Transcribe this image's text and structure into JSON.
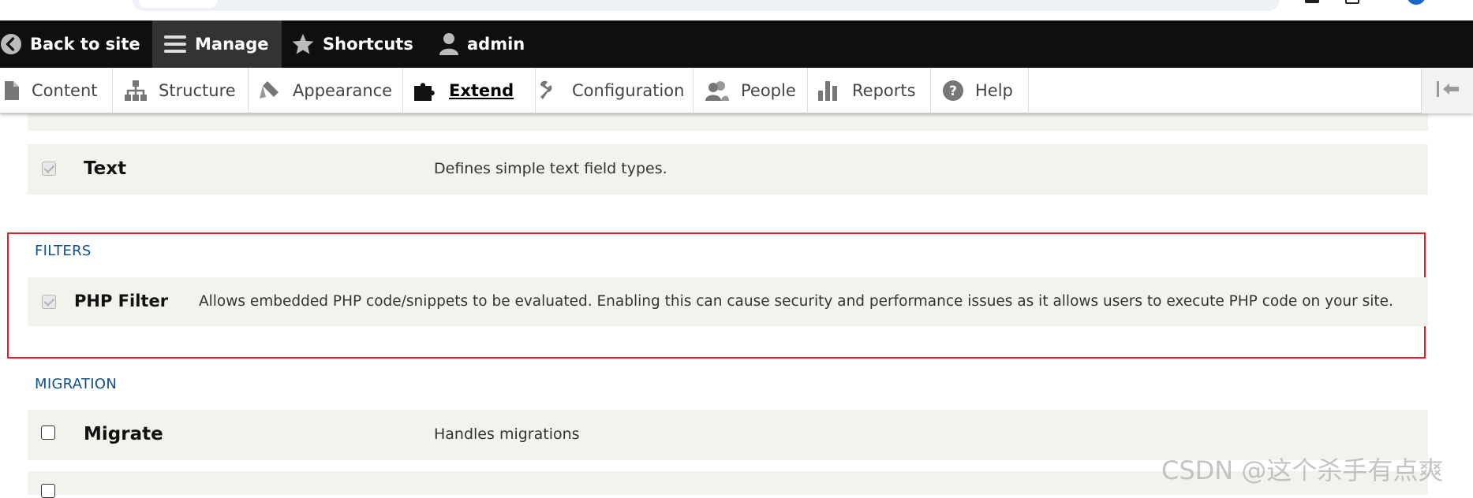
{
  "toolbar": {
    "back_to_site": "Back to site",
    "manage": "Manage",
    "shortcuts": "Shortcuts",
    "user": "admin"
  },
  "tray": {
    "items": [
      {
        "label": "Content",
        "icon": "file-icon"
      },
      {
        "label": "Structure",
        "icon": "sitemap-icon"
      },
      {
        "label": "Appearance",
        "icon": "paintbrush-icon"
      },
      {
        "label": "Extend",
        "icon": "puzzle-icon",
        "active": true
      },
      {
        "label": "Configuration",
        "icon": "wrench-icon"
      },
      {
        "label": "People",
        "icon": "people-icon"
      },
      {
        "label": "Reports",
        "icon": "bar-chart-icon"
      },
      {
        "label": "Help",
        "icon": "help-icon"
      }
    ]
  },
  "modules": {
    "text": {
      "name": "Text",
      "description": "Defines simple text field types.",
      "checked": true,
      "disabled": true
    },
    "filters": {
      "section_title": "FILTERS",
      "php_filter": {
        "name": "PHP Filter",
        "description": "Allows embedded PHP code/snippets to be evaluated. Enabling this can cause security and performance issues as it allows users to execute PHP code on your site.",
        "checked": true,
        "disabled": true
      }
    },
    "migration": {
      "section_title": "MIGRATION",
      "migrate": {
        "name": "Migrate",
        "description": "Handles migrations",
        "checked": false
      }
    }
  },
  "watermark": "CSDN @这个杀手有点爽",
  "colors": {
    "toolbar_bg": "#0f0f0f",
    "toolbar_active": "#333333",
    "section_title": "#12508a",
    "highlight_border": "#e0202a",
    "row_bg": "#f3f3ee"
  }
}
